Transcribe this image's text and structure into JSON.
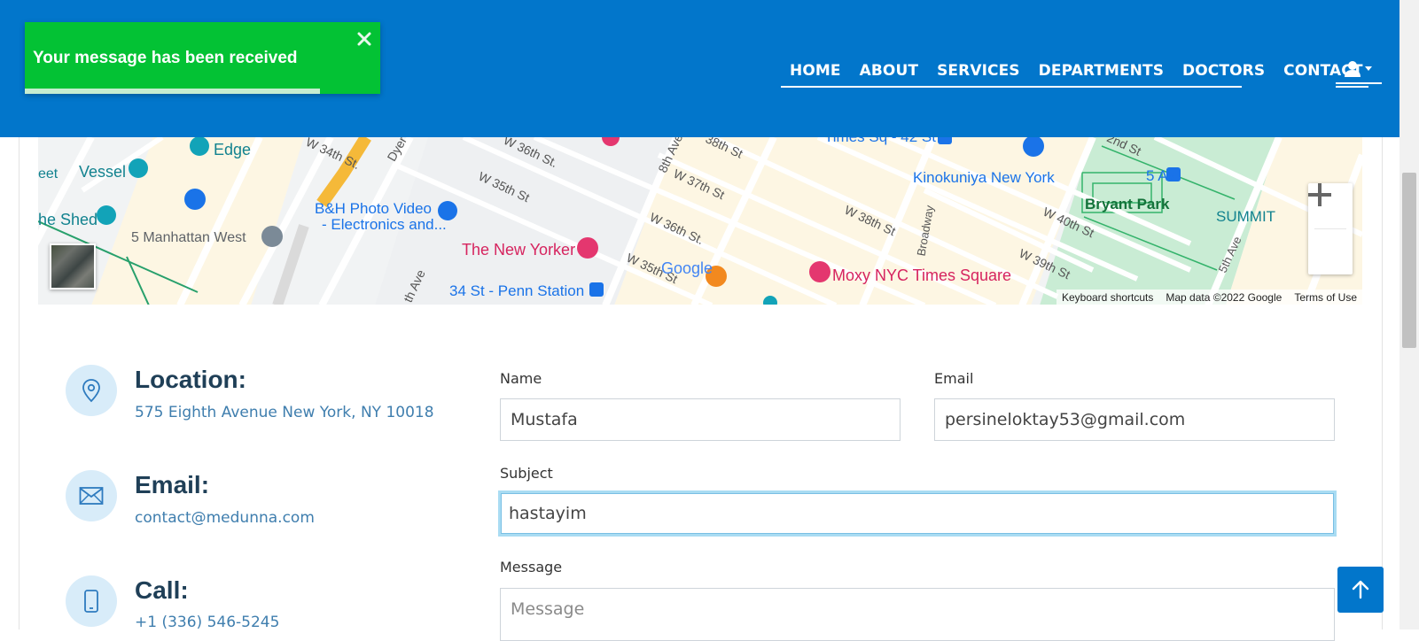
{
  "toast": {
    "message": "Your message has been received",
    "progress": 0.83
  },
  "nav": {
    "items": [
      "HOME",
      "ABOUT",
      "SERVICES",
      "DEPARTMENTS",
      "DOCTORS",
      "CONTACT"
    ],
    "user_icon": "user-icon"
  },
  "map": {
    "labels": [
      "Edge",
      "Vessel",
      "eet",
      "he Shed",
      "5 Manhattan West",
      "W 34th St.",
      "Dyer",
      "W 36th St.",
      "W 35th St",
      "B&H Photo Video",
      "- Electronics and...",
      "The New Yorker",
      "8th Ave",
      "W 37th St",
      "W 36th St.",
      "W 35th St",
      "38th St",
      "Times Sq - 42 St",
      "Kinokuniya New York",
      "W 38th St",
      "Broadway",
      "Moxy NYC Times Square",
      "W 39th St",
      "W 40th St",
      "2nd St",
      "5 Av",
      "Bryant Park",
      "SUMMIT",
      "5th Ave",
      "34 St - Penn Station",
      "th Ave",
      "Google"
    ],
    "attribution": {
      "shortcuts": "Keyboard shortcuts",
      "data": "Map data ©2022 Google",
      "terms": "Terms of Use"
    }
  },
  "contact": {
    "location": {
      "title": "Location:",
      "value": "575 Eighth Avenue New York, NY 10018"
    },
    "email": {
      "title": "Email:",
      "value": "contact@medunna.com"
    },
    "call": {
      "title": "Call:",
      "value": "+1 (336) 546-5245"
    }
  },
  "form": {
    "name_label": "Name",
    "name_value": "Mustafa",
    "email_label": "Email",
    "email_value": "persineloktay53@gmail.com",
    "subject_label": "Subject",
    "subject_value": "hastayim",
    "message_label": "Message",
    "message_placeholder": "Message"
  },
  "colors": {
    "header": "#0276cb",
    "toast": "#03c234",
    "accent_text": "#3f7eae",
    "title_text": "#1f3f57",
    "icon_bg": "#d8ecf9"
  }
}
